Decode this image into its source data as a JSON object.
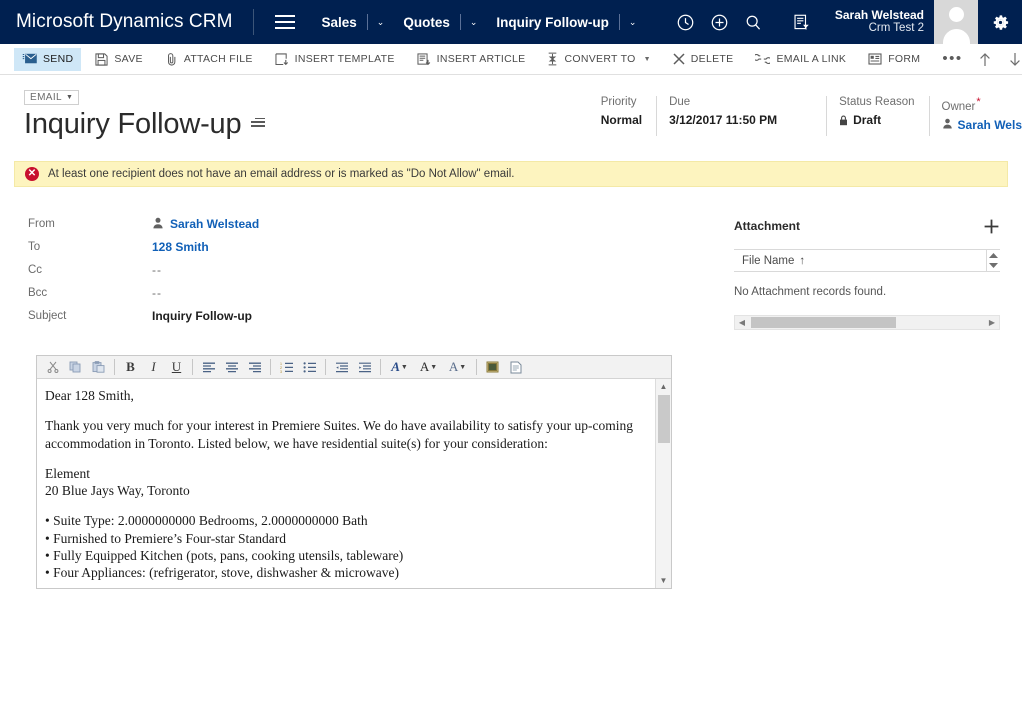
{
  "topnav": {
    "brand": "Microsoft Dynamics CRM",
    "menu_icon": "hamburger-icon",
    "items": [
      {
        "label": "Sales",
        "chevron": "⌄"
      },
      {
        "label": "Quotes",
        "chevron": "⌄"
      },
      {
        "label": "Inquiry Follow-up",
        "chevron": "⌄"
      }
    ],
    "icons": [
      {
        "name": "recent-clock-icon"
      },
      {
        "name": "quick-create-plus-icon"
      },
      {
        "name": "search-icon"
      },
      {
        "name": "advanced-find-icon"
      }
    ],
    "user": {
      "name": "Sarah Welstead",
      "org": "Crm Test 2"
    },
    "avatar": "user-avatar",
    "settings": "gear-icon"
  },
  "commandbar": {
    "buttons": [
      {
        "label": "SEND",
        "icon": "send-mail-icon",
        "active": true,
        "caret": false
      },
      {
        "label": "SAVE",
        "icon": "save-disk-icon",
        "active": false,
        "caret": false
      },
      {
        "label": "ATTACH FILE",
        "icon": "paperclip-icon",
        "active": false,
        "caret": false
      },
      {
        "label": "INSERT TEMPLATE",
        "icon": "insert-template-icon",
        "active": false,
        "caret": false
      },
      {
        "label": "INSERT ARTICLE",
        "icon": "insert-article-icon",
        "active": false,
        "caret": false
      },
      {
        "label": "CONVERT TO",
        "icon": "convert-to-icon",
        "active": false,
        "caret": true
      },
      {
        "label": "DELETE",
        "icon": "delete-x-icon",
        "active": false,
        "caret": false
      },
      {
        "label": "EMAIL A LINK",
        "icon": "link-icon",
        "active": false,
        "caret": false
      },
      {
        "label": "FORM",
        "icon": "form-icon",
        "active": false,
        "caret": false
      }
    ],
    "overflow_label": "•••",
    "right_icons": [
      {
        "name": "previous-record-up-icon"
      },
      {
        "name": "next-record-down-icon"
      },
      {
        "name": "popout-expand-icon"
      }
    ]
  },
  "record": {
    "entity_pill": "EMAIL",
    "title": "Inquiry Follow-up",
    "title_menu_icon": "record-set-menu-icon",
    "header_fields": [
      {
        "label": "Priority",
        "value": "Normal",
        "required": false,
        "link": false,
        "lock": false
      },
      {
        "label": "Due",
        "value": "3/12/2017   11:50 PM",
        "required": false,
        "link": false,
        "lock": false
      },
      {
        "label": "Status Reason",
        "value": "Draft",
        "required": false,
        "link": false,
        "lock": true
      },
      {
        "label": "Owner",
        "value": "Sarah Wels",
        "required": true,
        "link": true,
        "lock": false
      }
    ]
  },
  "notification": {
    "icon": "error-circle-icon",
    "text": "At least one recipient does not have an email address or is marked as \"Do Not Allow\" email."
  },
  "email_fields": [
    {
      "label": "From",
      "value": "Sarah Welstead",
      "type": "link-person"
    },
    {
      "label": "To",
      "value": "128 Smith",
      "type": "link"
    },
    {
      "label": "Cc",
      "value": "--",
      "type": "dash"
    },
    {
      "label": "Bcc",
      "value": "--",
      "type": "dash"
    },
    {
      "label": "Subject",
      "value": "Inquiry Follow-up",
      "type": "bold"
    }
  ],
  "attachment": {
    "title": "Attachment",
    "add_icon": "add-plus-icon",
    "column_header": "File Name",
    "sort_indicator": "↑",
    "spinner_icon": "record-spinner-icon",
    "empty_message": "No Attachment records found.",
    "hscroll_left_icon": "◀",
    "hscroll_right_icon": "▶"
  },
  "editor": {
    "toolbar": [
      {
        "name": "cut-icon",
        "glyph": "✂",
        "sep_after": false
      },
      {
        "name": "copy-icon",
        "glyph": "⧉",
        "sep_after": false
      },
      {
        "name": "paste-icon",
        "glyph": "ὌB",
        "sep_after": true
      },
      {
        "name": "bold-icon",
        "glyph": "B",
        "sep_after": false
      },
      {
        "name": "italic-icon",
        "glyph": "I",
        "sep_after": false
      },
      {
        "name": "underline-icon",
        "glyph": "U",
        "sep_after": true
      },
      {
        "name": "align-left-icon",
        "glyph": "≡",
        "sep_after": false
      },
      {
        "name": "align-center-icon",
        "glyph": "≡",
        "sep_after": false
      },
      {
        "name": "align-right-icon",
        "glyph": "≡",
        "sep_after": true
      },
      {
        "name": "numbered-list-icon",
        "glyph": "≣",
        "sep_after": false
      },
      {
        "name": "bulleted-list-icon",
        "glyph": "≣",
        "sep_after": true
      },
      {
        "name": "decrease-indent-icon",
        "glyph": "⇤",
        "sep_after": false
      },
      {
        "name": "increase-indent-icon",
        "glyph": "⇥",
        "sep_after": true
      },
      {
        "name": "text-color-icon",
        "glyph": "A",
        "caret": true,
        "sep_after": false
      },
      {
        "name": "font-size-icon",
        "glyph": "A",
        "caret": true,
        "sep_after": false
      },
      {
        "name": "font-family-icon",
        "glyph": "A",
        "caret": true,
        "sep_after": true
      },
      {
        "name": "insert-image-icon",
        "glyph": "▣",
        "sep_after": false
      },
      {
        "name": "insert-page-icon",
        "glyph": "὜E",
        "sep_after": false
      }
    ],
    "body_lines": [
      "Dear 128 Smith,",
      "",
      "Thank you very much for your interest in Premiere Suites. We do have availability to satisfy your up-coming accommodation in Toronto. Listed below, we have residential suite(s) for your consideration:",
      "",
      "Element",
      "20 Blue Jays Way, Toronto",
      "",
      "• Suite Type: 2.0000000000 Bedrooms, 2.0000000000 Bath",
      "• Furnished to Premiere’s Four-star Standard",
      "• Fully Equipped Kitchen (pots, pans, cooking utensils, tableware)",
      "• Four Appliances: (refrigerator, stove, dishwasher & microwave)"
    ],
    "scroll_up_icon": "▲",
    "scroll_down_icon": "▼"
  },
  "colors": {
    "navbar": "#002050",
    "accent_link": "#1160b7",
    "notification_bg": "#fdf4bf",
    "error_red": "#c8102e",
    "active_command": "#cfe7f7"
  }
}
